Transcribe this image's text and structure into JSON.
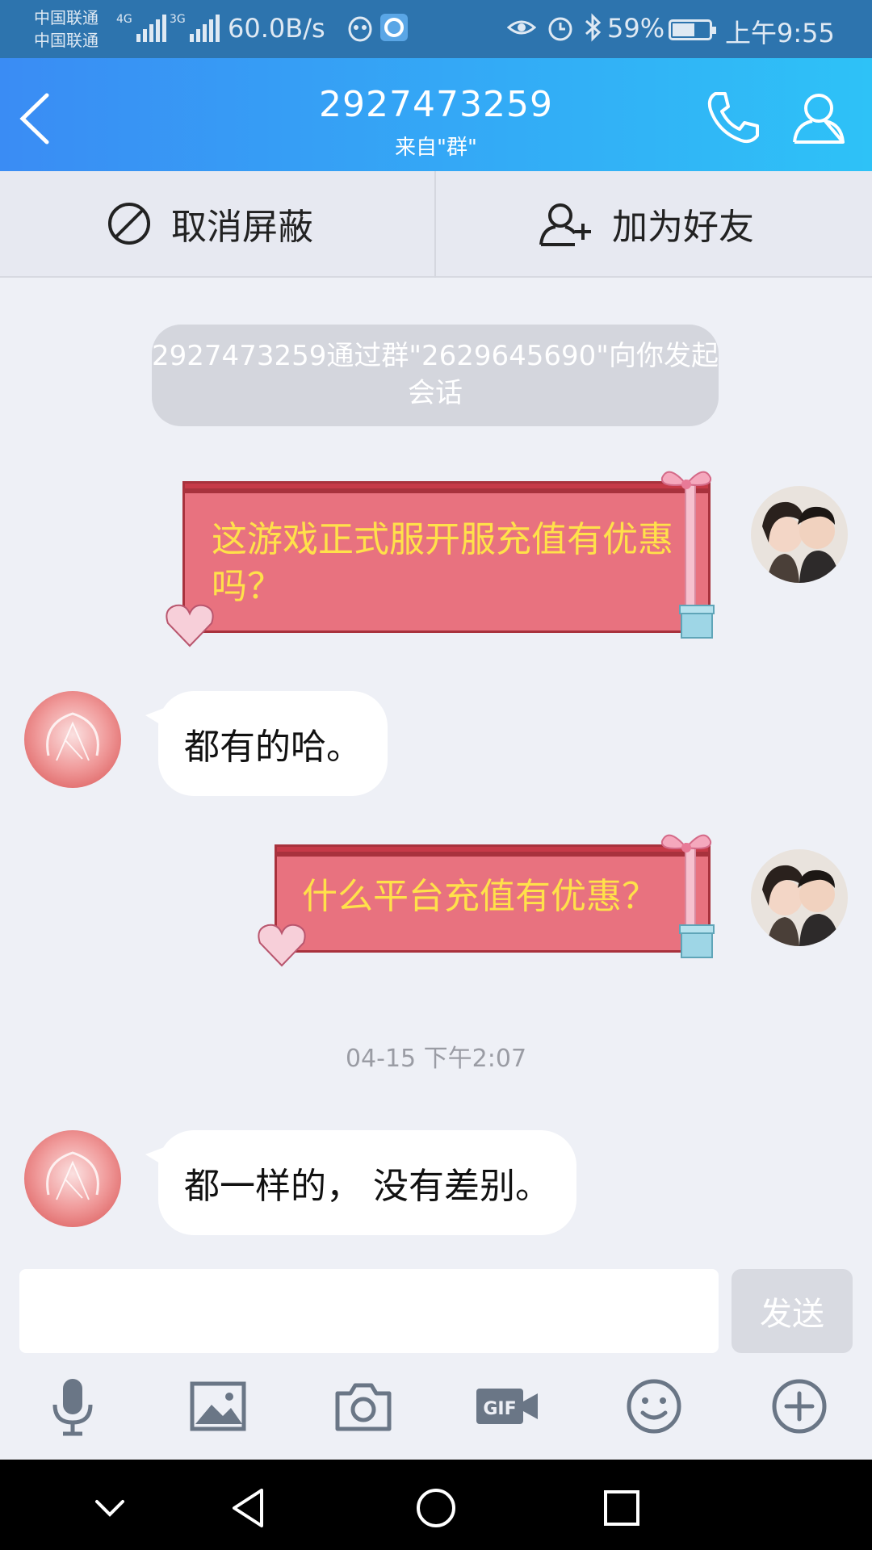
{
  "status_bar": {
    "carrier_1": "中国联通",
    "carrier_2": "中国联通",
    "network_1": "4G",
    "network_2": "3G",
    "net_speed": "60.0B/s",
    "battery_percent": "59%",
    "battery_level": 0.59,
    "time": "上午9:55"
  },
  "header": {
    "title": "2927473259",
    "subtitle": "来自\"群\""
  },
  "actions": {
    "unblock_label": "取消屏蔽",
    "add_friend_label": "加为好友"
  },
  "system_notice": {
    "text": "2927473259通过群\"2629645690\"向你发起会话"
  },
  "messages": [
    {
      "side": "sent",
      "text": "这游戏正式服开服充值有优惠吗？"
    },
    {
      "side": "received",
      "text": "都有的哈。"
    },
    {
      "side": "sent",
      "text": "什么平台充值有优惠？"
    },
    {
      "side": "received",
      "text": "都一样的， 没有差别。"
    }
  ],
  "timestamp": "04-15 下午2:07",
  "input": {
    "value": "",
    "send_label": "发送"
  },
  "toolbar_icons": [
    "microphone-icon",
    "image-icon",
    "camera-icon",
    "gif-icon",
    "emoji-icon",
    "plus-icon"
  ],
  "colors": {
    "header_start": "#3a8cf4",
    "header_end": "#2ec2f7",
    "gift_bubble": "#e8727f",
    "gift_text": "#ffe14a"
  }
}
